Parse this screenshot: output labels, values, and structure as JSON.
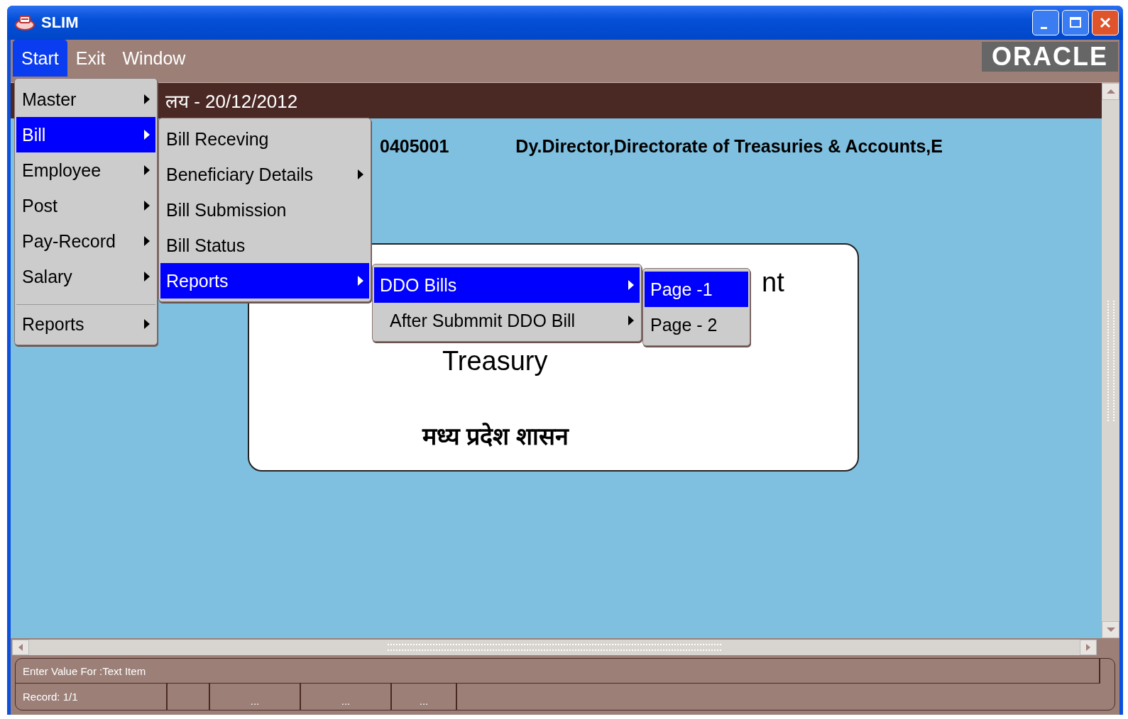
{
  "window": {
    "title": "SLIM"
  },
  "menubar": [
    {
      "label": "Start",
      "selected": true
    },
    {
      "label": "Exit",
      "selected": false
    },
    {
      "label": "Window",
      "selected": false
    }
  ],
  "logo": "ORACLE",
  "header": {
    "text": "लय - 20/12/2012"
  },
  "info": {
    "code": "0405001",
    "office": "Dy.Director,Directorate of Treasuries & Accounts,E"
  },
  "card": {
    "fragment": "nt",
    "title": "Treasury",
    "subtitle": "मध्य प्रदेश शासन"
  },
  "start_menu": [
    {
      "kind": "item",
      "label": "Master",
      "submenu": true,
      "selected": false
    },
    {
      "kind": "item",
      "label": "Bill",
      "submenu": true,
      "selected": true
    },
    {
      "kind": "item",
      "label": "Employee",
      "submenu": true,
      "selected": false
    },
    {
      "kind": "item",
      "label": "Post",
      "submenu": true,
      "selected": false
    },
    {
      "kind": "item",
      "label": "Pay-Record",
      "submenu": true,
      "selected": false
    },
    {
      "kind": "item",
      "label": "Salary",
      "submenu": true,
      "selected": false
    },
    {
      "kind": "separator"
    },
    {
      "kind": "item",
      "label": "Reports",
      "submenu": true,
      "selected": false
    }
  ],
  "bill_menu": [
    {
      "kind": "item",
      "label": "Bill Receving",
      "submenu": false,
      "selected": false
    },
    {
      "kind": "item",
      "label": "Beneficiary Details",
      "submenu": true,
      "selected": false
    },
    {
      "kind": "item",
      "label": "Bill Submission",
      "submenu": false,
      "selected": false
    },
    {
      "kind": "item",
      "label": "Bill Status",
      "submenu": false,
      "selected": false
    },
    {
      "kind": "item",
      "label": "Reports",
      "submenu": true,
      "selected": true
    }
  ],
  "reports_menu": [
    {
      "kind": "item",
      "label": "DDO Bills",
      "submenu": true,
      "selected": true
    },
    {
      "kind": "item",
      "label": "After Submmit DDO Bill",
      "submenu": true,
      "selected": false
    }
  ],
  "page_menu": [
    {
      "kind": "item",
      "label": "Page -1",
      "submenu": false,
      "selected": true
    },
    {
      "kind": "item",
      "label": "Page - 2",
      "submenu": false,
      "selected": false
    }
  ],
  "status_bar": {
    "message": "Enter Value For :Text Item",
    "record": "Record: 1/1",
    "fields": [
      "...",
      "...",
      "..."
    ]
  }
}
